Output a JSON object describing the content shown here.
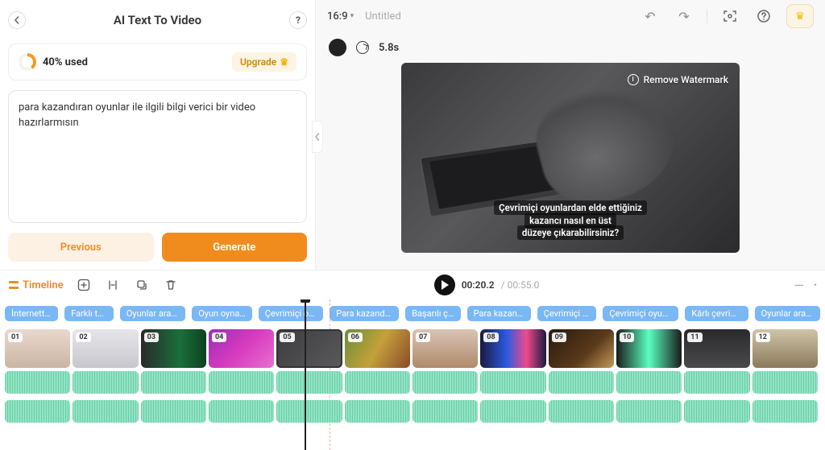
{
  "panel": {
    "title": "AI Text To Video",
    "usage": "40% used",
    "upgrade": "Upgrade",
    "prompt": "para kazandıran oyunlar ile ilgili bilgi verici bir video hazırlarmısın",
    "previous": "Previous",
    "generate": "Generate"
  },
  "topbar": {
    "aspect": "16:9",
    "title": "Untitled"
  },
  "preview": {
    "duration": "5.8s",
    "watermark": "Remove Watermark",
    "subtitle_line1": "Çevrimiçi oyunlardan elde ettiğiniz kazancı nasıl en üst",
    "subtitle_line2": "düzeye çıkarabilirsiniz?"
  },
  "timeline": {
    "label": "Timeline",
    "current": "00:20.2",
    "total": "00:55.0",
    "clips": [
      "İnternetten ...",
      "Farklı türd...",
      "Oyunlar aracılığ...",
      "Oyun oynama...",
      "Çevrimiçi oyunl...",
      "Para kazandıran ...",
      "Başarılı çevr...",
      "Para kazandıra...",
      "Çevrimiçi oyu...",
      "Çevrimiçi oyun oyn...",
      "Kârlı çevrimiçi ...",
      "Oyunlar aracılığ..."
    ],
    "thumbs": [
      "01",
      "02",
      "03",
      "04",
      "05",
      "06",
      "07",
      "08",
      "09",
      "10",
      "11",
      "12"
    ]
  }
}
